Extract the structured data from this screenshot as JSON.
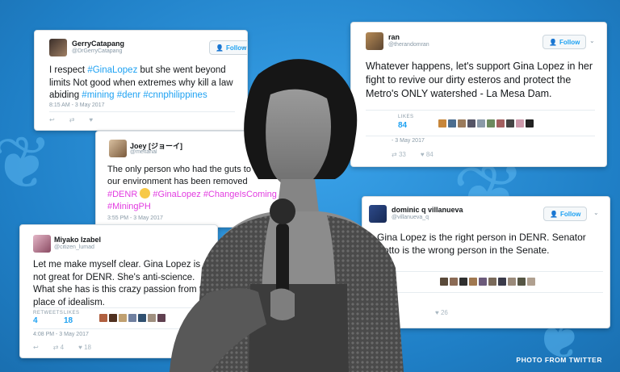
{
  "credit": "PHOTO FROM TWITTER",
  "colors": {
    "background": "#2a8fd8",
    "link": "#1da1f2"
  },
  "tweets": [
    {
      "name": "GerryCatapang",
      "handle": "@DrGerryCatapang",
      "follow": "Follow",
      "text_plain": "I respect ",
      "tag1": "#GinaLopez",
      "text_mid": " but she went beyond limits Not good when extremes why kill a law abiding ",
      "tag2": "#mining",
      "tag3": "#denr",
      "tag4": "#cnnphilippines",
      "time": "8:15 AM - 3 May 2017"
    },
    {
      "name": "ran",
      "handle": "@therandomran",
      "follow": "Follow",
      "text": "Whatever happens, let's support Gina Lopez in her fight to revive our dirty esteros and protect the Metro's ONLY watershed - La Mesa Dam.",
      "likes_label": "LIKES",
      "likes": "84",
      "time": "- 3 May 2017",
      "retweets_small": "33",
      "likes_small": "84"
    },
    {
      "name": "Joey [ジョーイ]",
      "handle": "@meltanal",
      "text": "The only person who had the guts to fight for our environment has been removed",
      "tag1": "#DENR",
      "tag2": "#GinaLopez",
      "tag3": "#ChangeIsComing",
      "tag4": "#MiningPH",
      "time": "3:55 PM - 3 May 2017"
    },
    {
      "name": "dominic q villanueva",
      "handle": "@villanueva_q",
      "follow": "Follow",
      "text": "Gina Lopez is the right  person in DENR. Senator Sotto is the wrong person in the Senate.",
      "likes_small": "26"
    },
    {
      "name": "Miyako Izabel",
      "handle": "@citizen_lumad",
      "text": "Let me make myself clear. Gina Lopez is not great for DENR. She's anti-science. What she has is this crazy passion from the place of idealism.",
      "retweets_label": "RETWEETS",
      "retweets": "4",
      "likes_label": "LIKES",
      "likes": "18",
      "time": "4:08 PM - 3 May 2017",
      "retweets_small": "4",
      "likes_small": "18"
    }
  ]
}
